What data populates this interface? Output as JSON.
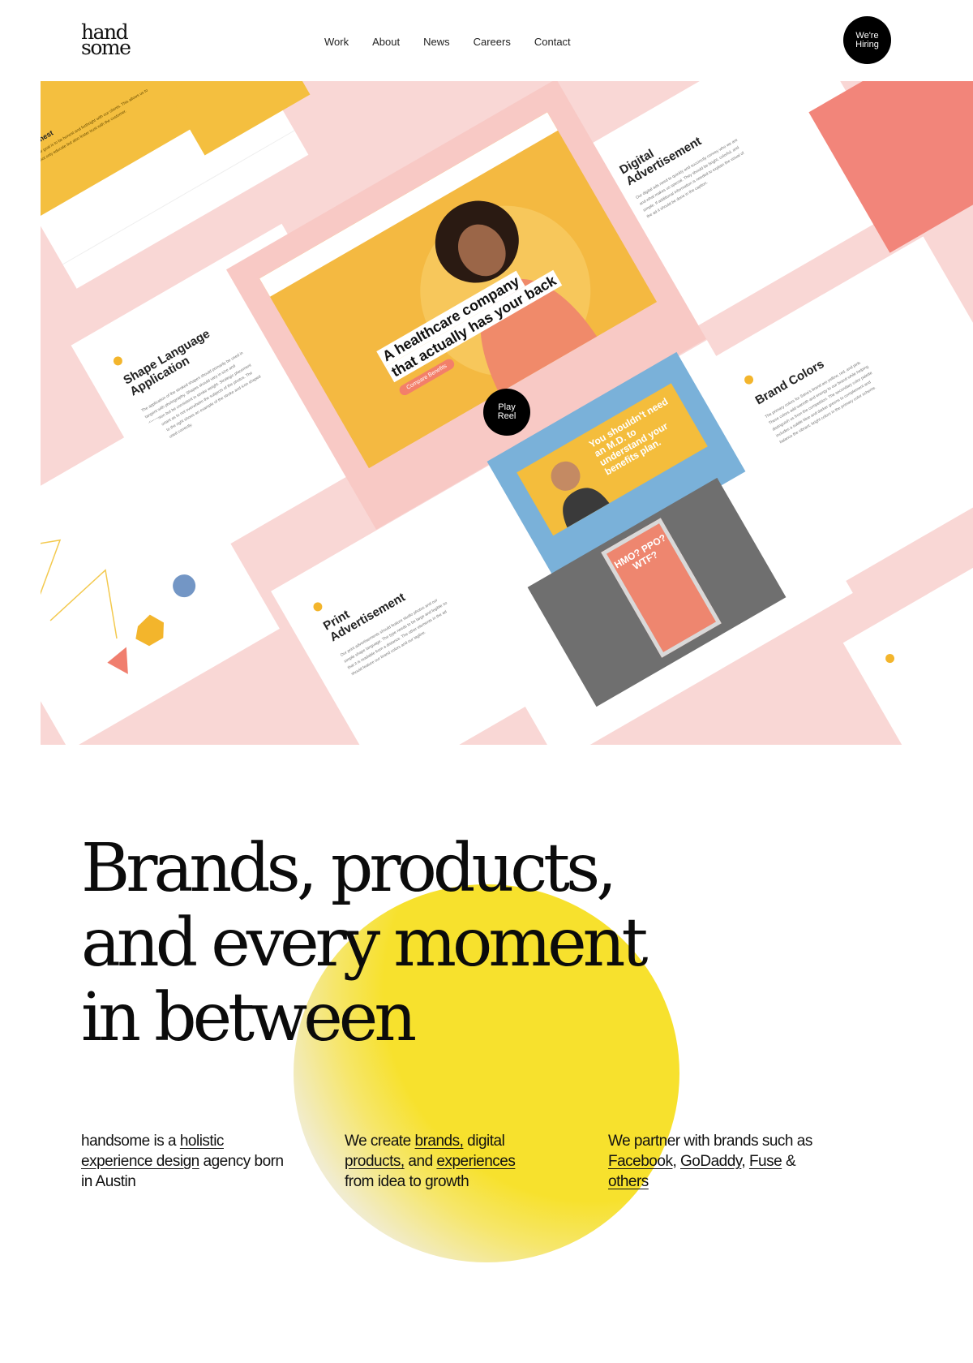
{
  "header": {
    "logo_line1": "hand",
    "logo_line2": "some",
    "nav": [
      "Work",
      "About",
      "News",
      "Careers",
      "Contact"
    ],
    "hiring_line1": "We're",
    "hiring_line2": "Hiring"
  },
  "hero": {
    "play_line1": "Play",
    "play_line2": "Reel",
    "cards": {
      "honest_title": "Honest",
      "honest_body": "Our goal is to be honest and forthright with our clients. This allows us to not only educate but also foster trust with the customer.",
      "digital_title_1": "Digital",
      "digital_title_2": "Advertisement",
      "digital_body": "Our digital ads need to quickly and succinctly convey who we are and what makes us special. They should be bright, colorful, and simple. If additional information is needed to explain the visual of the ad it should be done in the caption.",
      "shape_title_1": "Shape Language",
      "shape_title_2": "Application",
      "shape_body": "The application of the stroked shapes should primarily be used in tangent with photography. Shapes should vary in size and dimension but be consistent in stroke weight. Strategic placement is important as to not overwhelm the subjects of the photos. The image to the right shows an example of the stroke and icon shaped being used correctly.",
      "brand_title": "Brand Colors",
      "brand_body": "The primary colors for Sana's brand are yellow, red, and pink. These colors add warmth and energy to our brand while helping distinguish us from the competition. The secondary color palette includes a subtle blue and darker greens to complement and balance the vibrant, bright colors in the primary color scheme.",
      "print_title_1": "Print",
      "print_title_2": "Advertisement",
      "print_body": "Our print advertisements should feature studio photos and our simple shape language. The type needs to be large and legible so that it is readable from a distance. The other elements in the ad should feature our brand colors and our tagline."
    },
    "screen_headline_1": "A healthcare company",
    "screen_headline_2": "that actually has your back",
    "screen_cta": "Compare Benefits",
    "billboard_text": "You shouldn't need an M.D. to understand your benefits plan.",
    "poster_text": "HMO? PPO? WTF?"
  },
  "headline": {
    "line1": "Brands, products,",
    "line2": "and every moment",
    "line3": "in between"
  },
  "columns": {
    "col1": {
      "pre": "handsome is a ",
      "link1": "holistic experience design",
      "post": " agency born in Austin"
    },
    "col2": {
      "pre": "We create ",
      "link1": "brands,",
      "mid1": " digital ",
      "link2": "products,",
      "mid2": " and ",
      "link3": "experiences",
      "post": " from idea to growth"
    },
    "col3": {
      "pre": "We partner with brands such as ",
      "link1": "Facebook",
      "sep1": ", ",
      "link2": "GoDaddy",
      "sep2": ", ",
      "link3": "Fuse",
      "sep3": " & ",
      "link4": "others"
    }
  },
  "colors": {
    "accent_yellow": "#f7e12d",
    "hero_pink": "#f9d7d5",
    "card_yellow": "#f4bf3f",
    "coral": "#f2857a"
  }
}
